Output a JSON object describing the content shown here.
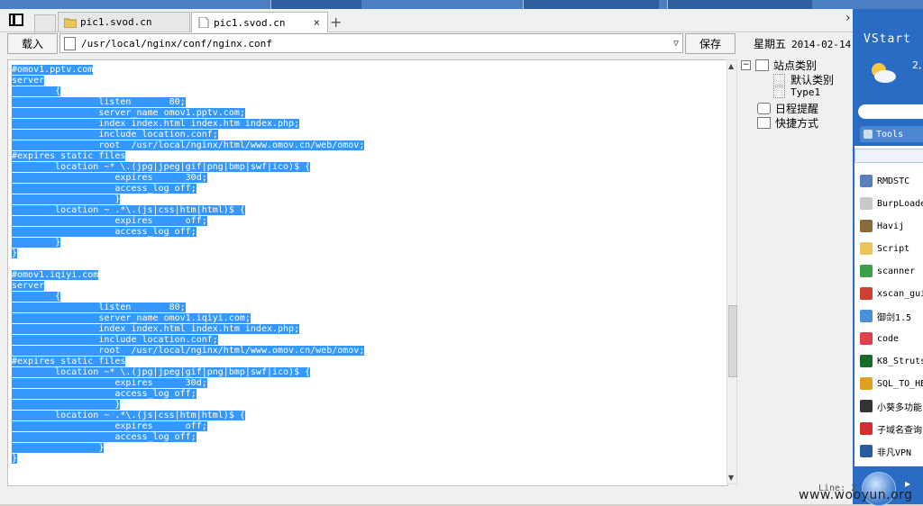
{
  "tabs": [
    {
      "title": "pic1.svod.cn",
      "active": false
    },
    {
      "title": "pic1.svod.cn",
      "active": true
    }
  ],
  "toolbar": {
    "load_label": "载入",
    "path_value": "/usr/local/nginx/conf/nginx.conf",
    "save_label": "保存",
    "weekday": "星期五",
    "date": "2014-02-14"
  },
  "tree": {
    "root": "站点类别",
    "children": [
      "默认类别",
      "Type1"
    ],
    "schedule": "日程提醒",
    "shortcuts": "快捷方式"
  },
  "code_lines": [
    "#omov1.pptv.com",
    "server",
    "        {",
    "                listen       80;",
    "                server_name omov1.pptv.com;",
    "                index index.html index.htm index.php;",
    "                include location.conf;",
    "                root  /usr/local/nginx/html/www.omov.cn/web/omov;",
    "#expires static files",
    "        location ~* \\.(jpg|jpeg|gif|png|bmp|swf|ico)$ {",
    "                   expires      30d;",
    "                   access_log off;",
    "                   }",
    "        location ~ .*\\.(js|css|htm|html)$ {",
    "                   expires      off;",
    "                   access_log off;",
    "        }",
    "}",
    "",
    "#omov1.iqiyi.com",
    "server",
    "        {",
    "                listen       80;",
    "                server_name omov1.iqiyi.com;",
    "                index index.html index.htm index.php;",
    "                include location.conf;",
    "                root  /usr/local/nginx/html/www.omov.cn/web/omov;",
    "#expires static files",
    "        location ~* \\.(jpg|jpeg|gif|png|bmp|swf|ico)$ {",
    "                   expires      30d;",
    "                   access_log off;",
    "                   }",
    "        location ~ .*\\.(js|css|htm|html)$ {",
    "                   expires      off;",
    "                   access_log off;",
    "                }",
    "}"
  ],
  "vstart": {
    "title": "VStart",
    "weather_value": "2,",
    "tools_tab": "Tools",
    "items": [
      {
        "label": "RMDSTC",
        "icon": "remote-desktop-icon",
        "color": "#5a7fb8"
      },
      {
        "label": "BurpLoade",
        "icon": "document-icon",
        "color": "#c9c9c9"
      },
      {
        "label": "Havij",
        "icon": "havij-icon",
        "color": "#8a6a3a"
      },
      {
        "label": "Script",
        "icon": "folder-icon",
        "color": "#e8c55a"
      },
      {
        "label": "scanner",
        "icon": "scanner-icon",
        "color": "#3aa04a"
      },
      {
        "label": "xscan_gui",
        "icon": "xscan-icon",
        "color": "#d04030"
      },
      {
        "label": "御剑1.5",
        "icon": "globe-icon",
        "color": "#4a90d9"
      },
      {
        "label": "code",
        "icon": "code-icon",
        "color": "#e04050"
      },
      {
        "label": "K8_Struts",
        "icon": "k8-icon",
        "color": "#1a6a2a"
      },
      {
        "label": "SQL_TO_HE",
        "icon": "sql-icon",
        "color": "#e0a020"
      },
      {
        "label": "小葵多功能",
        "icon": "xiaokui-icon",
        "color": "#333333"
      },
      {
        "label": "子域名查询",
        "icon": "subdomain-icon",
        "color": "#d03030"
      },
      {
        "label": "非凡VPN",
        "icon": "vpn-icon",
        "color": "#2a5aa0"
      }
    ]
  },
  "status": {
    "line": "Line: 2",
    "watermark": "www.wooyun.org"
  },
  "colors": {
    "selection": "#3399ff",
    "vstart_blue": "#2a6bc4"
  }
}
